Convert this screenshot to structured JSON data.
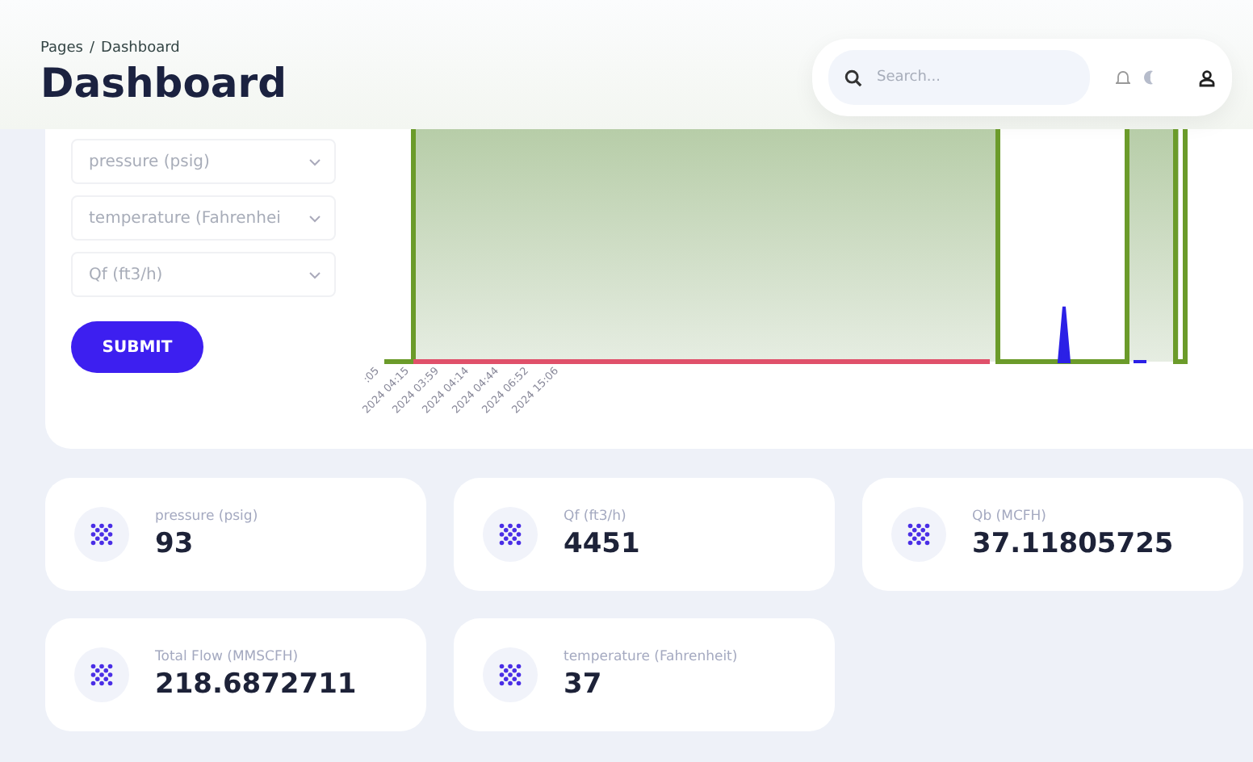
{
  "breadcrumb": {
    "items": [
      {
        "label": "Pages"
      },
      {
        "label": "Dashboard"
      }
    ],
    "separator": "/"
  },
  "page_title": "Dashboard",
  "search": {
    "placeholder": "Search..."
  },
  "form": {
    "selects": [
      {
        "value": "pressure (psig)"
      },
      {
        "value": "temperature (Fahrenhei"
      },
      {
        "value": "Qf (ft3/h)"
      }
    ],
    "submit": "SUBMIT"
  },
  "chart": {
    "x_labels": [
      ":05",
      "2024 04:15",
      "2024 03:59",
      "2024 04:14",
      "2024 04:44",
      "2024 06:52",
      "2024 15:06"
    ]
  },
  "stats": [
    {
      "label": "pressure (psig)",
      "value": "93"
    },
    {
      "label": "Qf (ft3/h)",
      "value": "4451"
    },
    {
      "label": "Qb (MCFH)",
      "value": "37.11805725"
    },
    {
      "label": "Total Flow (MMSCFH)",
      "value": "218.6872711"
    },
    {
      "label": "temperature (Fahrenheit)",
      "value": "37"
    }
  ]
}
